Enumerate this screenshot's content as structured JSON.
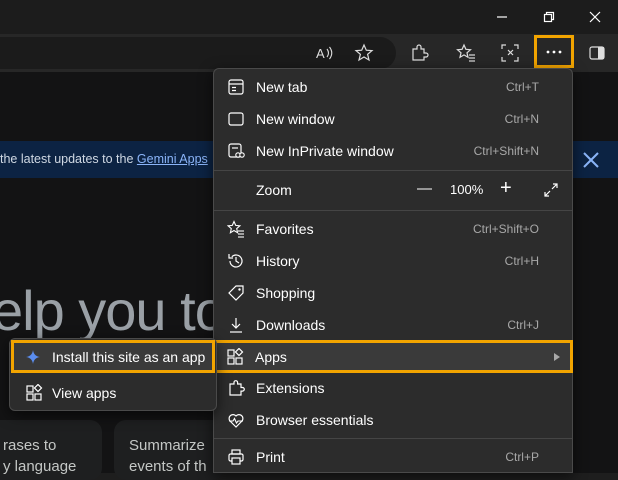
{
  "colors": {
    "highlight": "#f2a400",
    "accent_link": "#8ab4f8",
    "banner_bg": "#0c2343"
  },
  "page": {
    "banner_text": "the latest updates to the ",
    "banner_link": "Gemini Apps",
    "hero_text": "elp you to",
    "card1_line1": "rases to",
    "card1_line2": "y language",
    "card2_line1": "Summarize",
    "card2_line2": "events of th"
  },
  "menu": {
    "new_tab": {
      "label": "New tab",
      "shortcut": "Ctrl+T",
      "icon": "new-tab-icon"
    },
    "new_window": {
      "label": "New window",
      "shortcut": "Ctrl+N",
      "icon": "window-icon"
    },
    "new_inprivate": {
      "label": "New InPrivate window",
      "shortcut": "Ctrl+Shift+N",
      "icon": "inprivate-icon"
    },
    "zoom": {
      "label": "Zoom",
      "value": "100%",
      "minus": "—",
      "plus": "+"
    },
    "favorites": {
      "label": "Favorites",
      "shortcut": "Ctrl+Shift+O",
      "icon": "favorites-icon"
    },
    "history": {
      "label": "History",
      "shortcut": "Ctrl+H",
      "icon": "history-icon"
    },
    "shopping": {
      "label": "Shopping",
      "shortcut": "",
      "icon": "tag-icon"
    },
    "downloads": {
      "label": "Downloads",
      "shortcut": "Ctrl+J",
      "icon": "download-icon"
    },
    "apps": {
      "label": "Apps",
      "icon": "apps-icon"
    },
    "extensions": {
      "label": "Extensions",
      "icon": "extension-icon"
    },
    "browser_essentials": {
      "label": "Browser essentials",
      "icon": "heart-pulse-icon"
    },
    "print": {
      "label": "Print",
      "shortcut": "Ctrl+P",
      "icon": "printer-icon"
    }
  },
  "submenu": {
    "install": {
      "label": "Install this site as an app",
      "icon": "sparkle-icon"
    },
    "view_apps": {
      "label": "View apps",
      "icon": "apps-icon"
    }
  }
}
